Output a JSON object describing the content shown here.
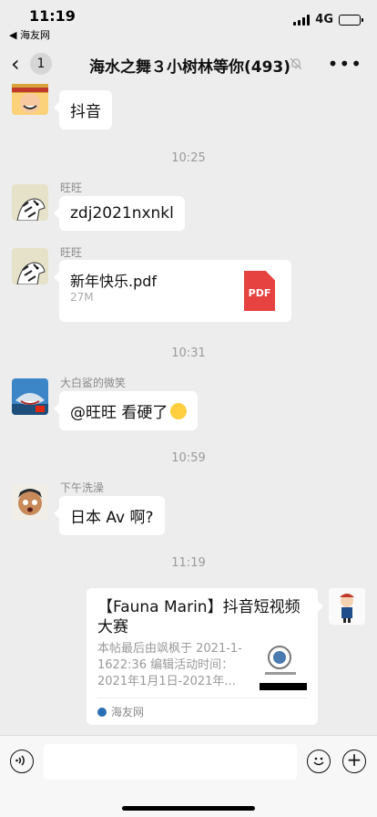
{
  "status": {
    "time": "11:19",
    "back_app": "◀ 海友网",
    "network": "4G",
    "battery_level": 0.85
  },
  "nav": {
    "back_count": "1",
    "title": "海水之舞３小树林等你(493)",
    "mute_icon": "bell-off-icon",
    "more_icon": "ellipsis-icon"
  },
  "messages": [
    {
      "sender": "",
      "text": "抖音"
    },
    {
      "time": "10:25"
    },
    {
      "sender": "旺旺",
      "text": "zdj2021nxnkl"
    },
    {
      "sender": "旺旺",
      "file": {
        "name": "新年快乐.pdf",
        "size": "27M",
        "icon_label": "PDF"
      }
    },
    {
      "time": "10:31"
    },
    {
      "sender": "大白鲨的微笑",
      "text": "@旺旺 看硬了"
    },
    {
      "time": "10:59"
    },
    {
      "sender": "下午洗澡",
      "text": "日本 Av 啊?"
    },
    {
      "time": "11:19"
    },
    {
      "link": {
        "title": "【Fauna Marin】抖音短视频大赛",
        "desc": "本帖最后由飒枫于 2021-1-1622:36 编辑活动时间：2021年1月1日-2021年...",
        "source": "海友网"
      }
    }
  ],
  "colors": {
    "background": "#ededed",
    "bubble": "#ffffff",
    "pdf": "#e64340",
    "timestamp": "#9b9b9b"
  }
}
